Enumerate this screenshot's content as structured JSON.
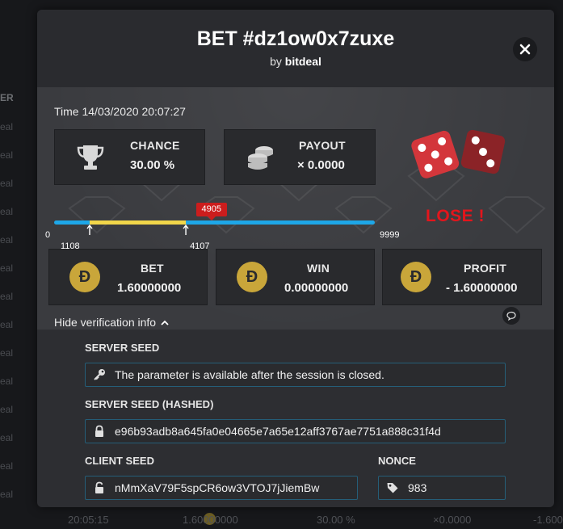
{
  "background": {
    "column_header": "ER",
    "row_text": "eal",
    "bottom_row": {
      "time": "20:05:15",
      "amount": "1.60000000",
      "chance": "30.00 %",
      "payout": "×0.0000",
      "right": "-1.600"
    }
  },
  "modal": {
    "title": "BET #dz1ow0x7zuxe",
    "subtitle_prefix": "by ",
    "subtitle_user": "bitdeal",
    "close_icon": "close-icon",
    "time": "Time 14/03/2020 20:07:27",
    "chance": {
      "label": "CHANCE",
      "value": "30.00 %",
      "icon": "trophy-icon"
    },
    "payout": {
      "label": "PAYOUT",
      "value": "× 0.0000",
      "icon": "coin-stack-icon"
    },
    "dice_icon": "dice-icon",
    "result_text": "LOSE !",
    "range": {
      "min_label": "0",
      "max_label": "9999",
      "win_from_label": "1108",
      "win_to_label": "4107",
      "roll_label": "4905",
      "min": 0,
      "max": 9999,
      "win_from": 1108,
      "win_to": 4107,
      "roll": 4905
    },
    "bet": {
      "label": "BET",
      "value": "1.60000000",
      "icon": "doge-coin-icon",
      "icon_glyph": "Đ"
    },
    "win": {
      "label": "WIN",
      "value": "0.00000000",
      "icon": "doge-coin-icon",
      "icon_glyph": "Đ"
    },
    "profit": {
      "label": "PROFIT",
      "value": "- 1.60000000",
      "icon": "doge-coin-icon",
      "icon_glyph": "Đ"
    },
    "toggle_verification": "Hide verification info",
    "server_seed": {
      "label": "SERVER SEED",
      "value": "The parameter is available after the session is closed.",
      "icon": "key-icon"
    },
    "server_seed_hashed": {
      "label": "SERVER SEED (HASHED)",
      "value": "e96b93adb8a645fa0e04665e7a65e12aff3767ae7751a888c31f4d",
      "icon": "lock-icon"
    },
    "client_seed": {
      "label": "CLIENT SEED",
      "value": "nMmXaV79F5spCR6ow3VTOJ7jJiemBw",
      "icon": "unlock-icon"
    },
    "nonce": {
      "label": "NONCE",
      "value": "983",
      "icon": "tag-icon"
    }
  },
  "colors": {
    "accent_blue": "#1ea7e8",
    "win_range_yellow": "#f1d64a",
    "lose_red": "#e3151c",
    "coin_gold": "#c9a63a",
    "field_border": "#255e78"
  }
}
